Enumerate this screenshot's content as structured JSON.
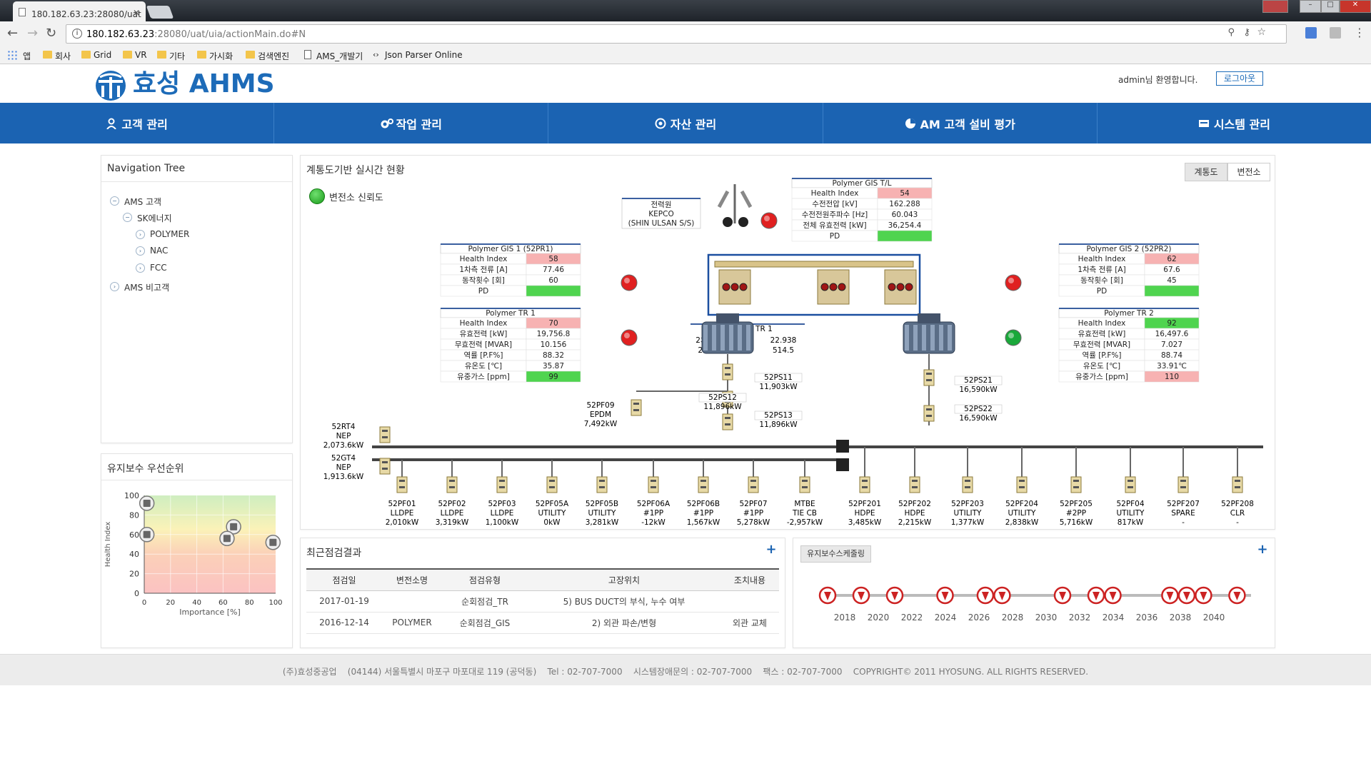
{
  "browser": {
    "tab_title": "180.182.63.23:28080/uat",
    "url_host": "180.182.63.23",
    "url_rest": ":28080/uat/uia/actionMain.do#N",
    "bookmarks": [
      "앱",
      "회사",
      "Grid",
      "VR",
      "기타",
      "가시화",
      "검색엔진",
      "AMS_개발기",
      "Json Parser Online"
    ]
  },
  "header": {
    "logo_text": "효성 AHMS",
    "welcome": "admin님 환영합니다.",
    "logout": "로그아웃"
  },
  "nav": [
    "고객 관리",
    "작업 관리",
    "자산 관리",
    "AM 고객 설비 평가",
    "시스템 관리"
  ],
  "tree": {
    "title": "Navigation Tree",
    "nodes": [
      {
        "label": "AMS 고객",
        "toggle": "−"
      },
      {
        "label": "SK에너지",
        "toggle": "−"
      },
      {
        "label": "POLYMER",
        "toggle": "›"
      },
      {
        "label": "NAC",
        "toggle": "›"
      },
      {
        "label": "FCC",
        "toggle": "›"
      },
      {
        "label": "AMS 비고객",
        "toggle": "›"
      }
    ]
  },
  "priority": {
    "title": "유지보수 우선순위",
    "ylabel": "Health Index",
    "xlabel": "Importance [%]"
  },
  "chart_data": {
    "type": "scatter",
    "title": "유지보수 우선순위",
    "xlabel": "Importance [%]",
    "ylabel": "Health Index",
    "x_ticks": [
      "0",
      "20",
      "40",
      "60",
      "80",
      "100"
    ],
    "y_ticks": [
      "0",
      "20",
      "40",
      "60",
      "80",
      "100"
    ],
    "xlim": [
      0,
      100
    ],
    "ylim": [
      0,
      100
    ],
    "points": [
      {
        "x": 2,
        "y": 92
      },
      {
        "x": 2,
        "y": 60
      },
      {
        "x": 68,
        "y": 68
      },
      {
        "x": 63,
        "y": 56
      },
      {
        "x": 98,
        "y": 52
      }
    ]
  },
  "sld": {
    "title": "계통도기반 실시간 현황",
    "tabs": [
      "계통도",
      "변전소"
    ],
    "legend": "변전소 신뢰도",
    "source_box": [
      "전력원",
      "KEPCO",
      "(SHIN ULSAN S/S)"
    ],
    "gis_tl": {
      "title": "Polymer GIS T/L",
      "rows": [
        [
          "Health Index",
          "54"
        ],
        [
          "수전전압 [kV]",
          "162.288"
        ],
        [
          "수전전원주파수 [Hz]",
          "60.043"
        ],
        [
          "전체 유효전력 [kW]",
          "36,254.4"
        ],
        [
          "PD",
          ""
        ]
      ],
      "colors": [
        "#f7b2b2",
        "",
        "",
        "",
        "#4fd44f"
      ]
    },
    "gis1": {
      "title": "Polymer GIS 1 (52PR1)",
      "rows": [
        [
          "Health Index",
          "58"
        ],
        [
          "1차측 전류 [A]",
          "77.46"
        ],
        [
          "동작횟수 [회]",
          "60"
        ],
        [
          "PD",
          ""
        ]
      ],
      "colors": [
        "#f7b2b2",
        "",
        "",
        "#4fd44f"
      ]
    },
    "gis2": {
      "title": "Polymer GIS 2 (52PR2)",
      "rows": [
        [
          "Health Index",
          "62"
        ],
        [
          "1차측 전류 [A]",
          "67.6"
        ],
        [
          "동작횟수 [회]",
          "45"
        ],
        [
          "PD",
          ""
        ]
      ],
      "colors": [
        "#f7b2b2",
        "",
        "",
        "#4fd44f"
      ]
    },
    "tr1": {
      "title": "Polymer TR 1",
      "rows": [
        [
          "Health Index",
          "70"
        ],
        [
          "유효전력 [kW]",
          "19,756.8"
        ],
        [
          "무효전력 [MVAR]",
          "10.156"
        ],
        [
          "역률 [P.F%]",
          "88.32"
        ],
        [
          "유온도 [℃]",
          "35.87"
        ],
        [
          "유중가스 [ppm]",
          "99"
        ]
      ],
      "colors": [
        "#f7b2b2",
        "",
        "",
        "",
        "",
        "#4fd44f"
      ]
    },
    "tr2": {
      "title": "Polymer TR 2",
      "rows": [
        [
          "Health Index",
          "92"
        ],
        [
          "유효전력 [kW]",
          "16,497.6"
        ],
        [
          "무효전력 [MVAR]",
          "7.027"
        ],
        [
          "역률 [P.F%]",
          "88.74"
        ],
        [
          "유온도 [℃]",
          "33.91℃"
        ],
        [
          "유중가스 [ppm]",
          "110"
        ]
      ],
      "colors": [
        "#4fd44f",
        "",
        "",
        "",
        "",
        "#f7b2b2"
      ]
    },
    "tr1_mid": {
      "title": "Polymer TR 1",
      "rows": [
        [
          "2차측 전압 [kV]",
          "22.938"
        ],
        [
          "2차측 전류 [A]",
          "514.5"
        ]
      ]
    },
    "ps_labels": [
      {
        "name": "52PS11",
        "val": "11,903kW"
      },
      {
        "name": "52PS12",
        "val": "11,896kW"
      },
      {
        "name": "52PS13",
        "val": "11,896kW"
      },
      {
        "name": "52PS21",
        "val": "16,590kW"
      },
      {
        "name": "52PS22",
        "val": "16,590kW"
      }
    ],
    "left_feeders": [
      {
        "name": "52RT4",
        "sub": "NEP",
        "val": "2,073.6kW"
      },
      {
        "name": "52GT4",
        "sub": "NEP",
        "val": "1,913.6kW"
      }
    ],
    "pf09": {
      "name": "52PF09",
      "sub": "EPDM",
      "val": "7,492kW"
    },
    "feeders": [
      {
        "name": "52PF01",
        "sub": "LLDPE",
        "val": "2,010kW"
      },
      {
        "name": "52PF02",
        "sub": "LLDPE",
        "val": "3,319kW"
      },
      {
        "name": "52PF03",
        "sub": "LLDPE",
        "val": "1,100kW"
      },
      {
        "name": "52PF05A",
        "sub": "UTILITY",
        "val": "0kW"
      },
      {
        "name": "52PF05B",
        "sub": "UTILITY",
        "val": "3,281kW"
      },
      {
        "name": "52PF06A",
        "sub": "#1PP",
        "val": "-12kW"
      },
      {
        "name": "52PF06B",
        "sub": "#1PP",
        "val": "1,567kW"
      },
      {
        "name": "52PF07",
        "sub": "#1PP",
        "val": "5,278kW"
      },
      {
        "name": "MTBE",
        "sub": "TIE CB",
        "val": "-2,957kW"
      },
      {
        "name": "52PF201",
        "sub": "HDPE",
        "val": "3,485kW"
      },
      {
        "name": "52PF202",
        "sub": "HDPE",
        "val": "2,215kW"
      },
      {
        "name": "52PF203",
        "sub": "UTILITY",
        "val": "1,377kW"
      },
      {
        "name": "52PF204",
        "sub": "UTILITY",
        "val": "2,838kW"
      },
      {
        "name": "52PF205",
        "sub": "#2PP",
        "val": "5,716kW"
      },
      {
        "name": "52PF04",
        "sub": "UTILITY",
        "val": "817kW"
      },
      {
        "name": "52PF207",
        "sub": "SPARE",
        "val": "-"
      },
      {
        "name": "52PF208",
        "sub": "CLR",
        "val": "-"
      }
    ]
  },
  "inspection": {
    "title": "최근점검결과",
    "headers": [
      "점검일",
      "변전소명",
      "점검유형",
      "고장위치",
      "조치내용"
    ],
    "rows": [
      [
        "2017-01-19",
        "",
        "순회점검_TR",
        "5) BUS DUCT의 부식, 누수 여부",
        ""
      ],
      [
        "2016-12-14",
        "POLYMER",
        "순회점검_GIS",
        "2) 외관 파손/변형",
        "외관 교체"
      ]
    ]
  },
  "schedule": {
    "title": "유지보수스케줄링",
    "years": [
      "2018",
      "2020",
      "2022",
      "2024",
      "2026",
      "2028",
      "2030",
      "2032",
      "2034",
      "2036",
      "2038",
      "2040"
    ]
  },
  "footer": {
    "text": "(주)효성중공업    (04144) 서울특별시 마포구 마포대로 119 (공덕동)    Tel : 02-707-7000    시스템장애문의 : 02-707-7000    팩스 : 02-707-7000    COPYRIGHT© 2011 HYOSUNG. ALL RIGHTS RESERVED."
  }
}
